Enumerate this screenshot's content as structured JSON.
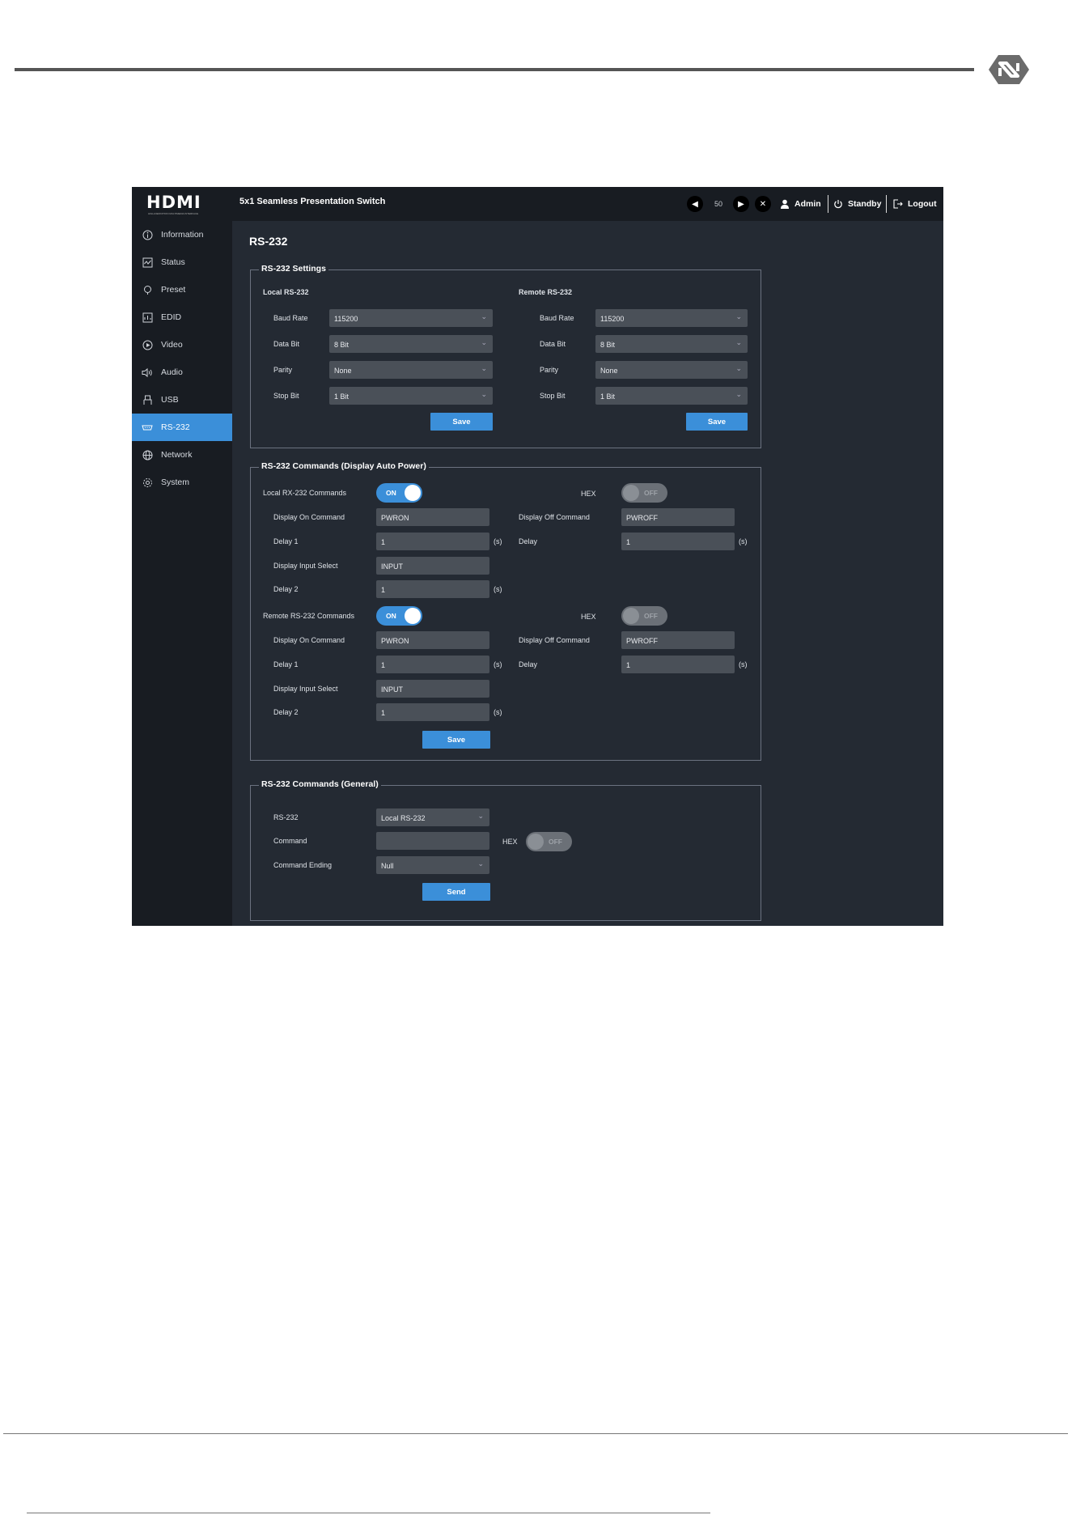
{
  "header": {
    "brand_wordmark": "HDMI",
    "brand_tagline": "HIGH-DEFINITION MULTIMEDIA INTERFACE",
    "device_title": "5x1 Seamless Presentation Switch",
    "volume_value": "50",
    "user_label": "Admin",
    "standby_label": "Standby",
    "logout_label": "Logout"
  },
  "sidebar": {
    "items": [
      {
        "label": "Information",
        "icon": "info-icon"
      },
      {
        "label": "Status",
        "icon": "status-icon"
      },
      {
        "label": "Preset",
        "icon": "preset-icon"
      },
      {
        "label": "EDID",
        "icon": "edid-icon"
      },
      {
        "label": "Video",
        "icon": "video-icon"
      },
      {
        "label": "Audio",
        "icon": "audio-icon"
      },
      {
        "label": "USB",
        "icon": "usb-icon"
      },
      {
        "label": "RS-232",
        "icon": "rs232-icon",
        "active": true
      },
      {
        "label": "Network",
        "icon": "network-icon"
      },
      {
        "label": "System",
        "icon": "system-icon"
      }
    ]
  },
  "main": {
    "title": "RS-232",
    "settings": {
      "legend": "RS-232 Settings",
      "local": {
        "heading": "Local RS-232",
        "baud_label": "Baud Rate",
        "baud_value": "115200",
        "data_label": "Data Bit",
        "data_value": "8 Bit",
        "parity_label": "Parity",
        "parity_value": "None",
        "stop_label": "Stop Bit",
        "stop_value": "1 Bit",
        "save_label": "Save"
      },
      "remote": {
        "heading": "Remote RS-232",
        "baud_label": "Baud Rate",
        "baud_value": "115200",
        "data_label": "Data Bit",
        "data_value": "8 Bit",
        "parity_label": "Parity",
        "parity_value": "None",
        "stop_label": "Stop Bit",
        "stop_value": "1 Bit",
        "save_label": "Save"
      }
    },
    "auto_power": {
      "legend": "RS-232 Commands (Display Auto Power)",
      "local": {
        "label": "Local RX-232 Commands",
        "toggle": "ON",
        "hex_label": "HEX",
        "hex_toggle": "OFF",
        "on_cmd_label": "Display On Command",
        "on_cmd_value": "PWRON",
        "delay1_label": "Delay 1",
        "delay1_value": "1",
        "input_label": "Display Input Select",
        "input_value": "INPUT",
        "delay2_label": "Delay 2",
        "delay2_value": "1",
        "off_cmd_label": "Display Off Command",
        "off_cmd_value": "PWROFF",
        "delay_label": "Delay",
        "delay_value": "1"
      },
      "remote": {
        "label": "Remote RS-232 Commands",
        "toggle": "ON",
        "hex_label": "HEX",
        "hex_toggle": "OFF",
        "on_cmd_label": "Display On Command",
        "on_cmd_value": "PWRON",
        "delay1_label": "Delay 1",
        "delay1_value": "1",
        "input_label": "Display Input Select",
        "input_value": "INPUT",
        "delay2_label": "Delay 2",
        "delay2_value": "1",
        "off_cmd_label": "Display Off Command",
        "off_cmd_value": "PWROFF",
        "delay_label": "Delay",
        "delay_value": "1"
      },
      "unit": "(s)",
      "save_label": "Save"
    },
    "general": {
      "legend": "RS-232 Commands (General)",
      "port_label": "RS-232",
      "port_value": "Local RS-232",
      "command_label": "Command",
      "command_value": "",
      "hex_label": "HEX",
      "hex_toggle": "OFF",
      "ending_label": "Command Ending",
      "ending_value": "Null",
      "send_label": "Send"
    }
  },
  "colors": {
    "accent": "#3b8fd9",
    "panel": "#242a33",
    "sidebar": "#181c22",
    "field": "#4a5058"
  }
}
